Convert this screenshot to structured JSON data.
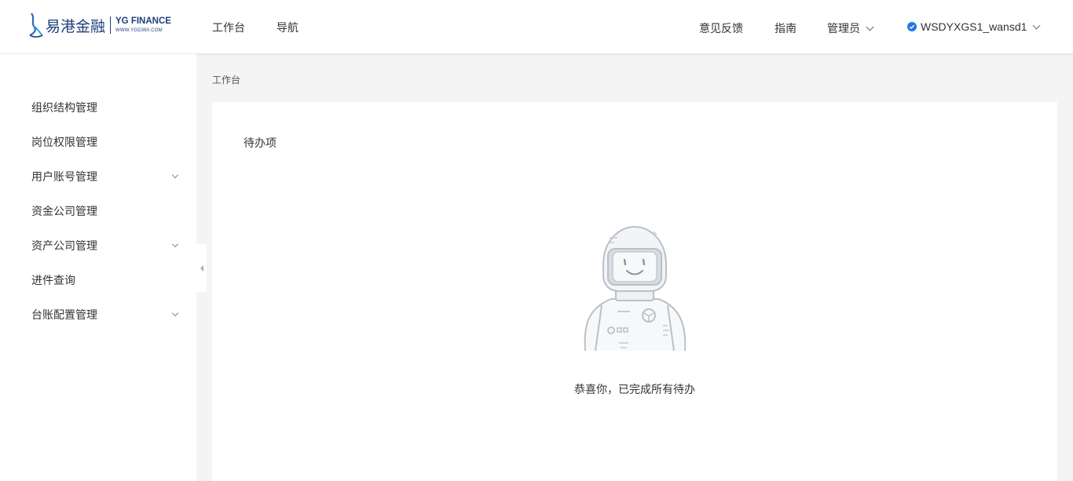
{
  "header": {
    "logo_cn": "易港金融",
    "logo_en": "YG FINANCE",
    "logo_sub": "WWW.YGD360.COM",
    "nav": [
      {
        "label": "工作台"
      },
      {
        "label": "导航"
      }
    ],
    "feedback": "意见反馈",
    "guide": "指南",
    "admin": "管理员",
    "username": "WSDYXGS1_wansd1"
  },
  "sidebar": {
    "items": [
      {
        "label": "组织结构管理",
        "expandable": false
      },
      {
        "label": "岗位权限管理",
        "expandable": false
      },
      {
        "label": "用户账号管理",
        "expandable": true
      },
      {
        "label": "资金公司管理",
        "expandable": false
      },
      {
        "label": "资产公司管理",
        "expandable": true
      },
      {
        "label": "进件查询",
        "expandable": false
      },
      {
        "label": "台账配置管理",
        "expandable": true
      }
    ]
  },
  "breadcrumb": "工作台",
  "todo": {
    "title": "待办项",
    "empty_message": "恭喜你，已完成所有待办"
  },
  "colors": {
    "brand": "#1f3f7a",
    "accent": "#1f7ae0"
  }
}
